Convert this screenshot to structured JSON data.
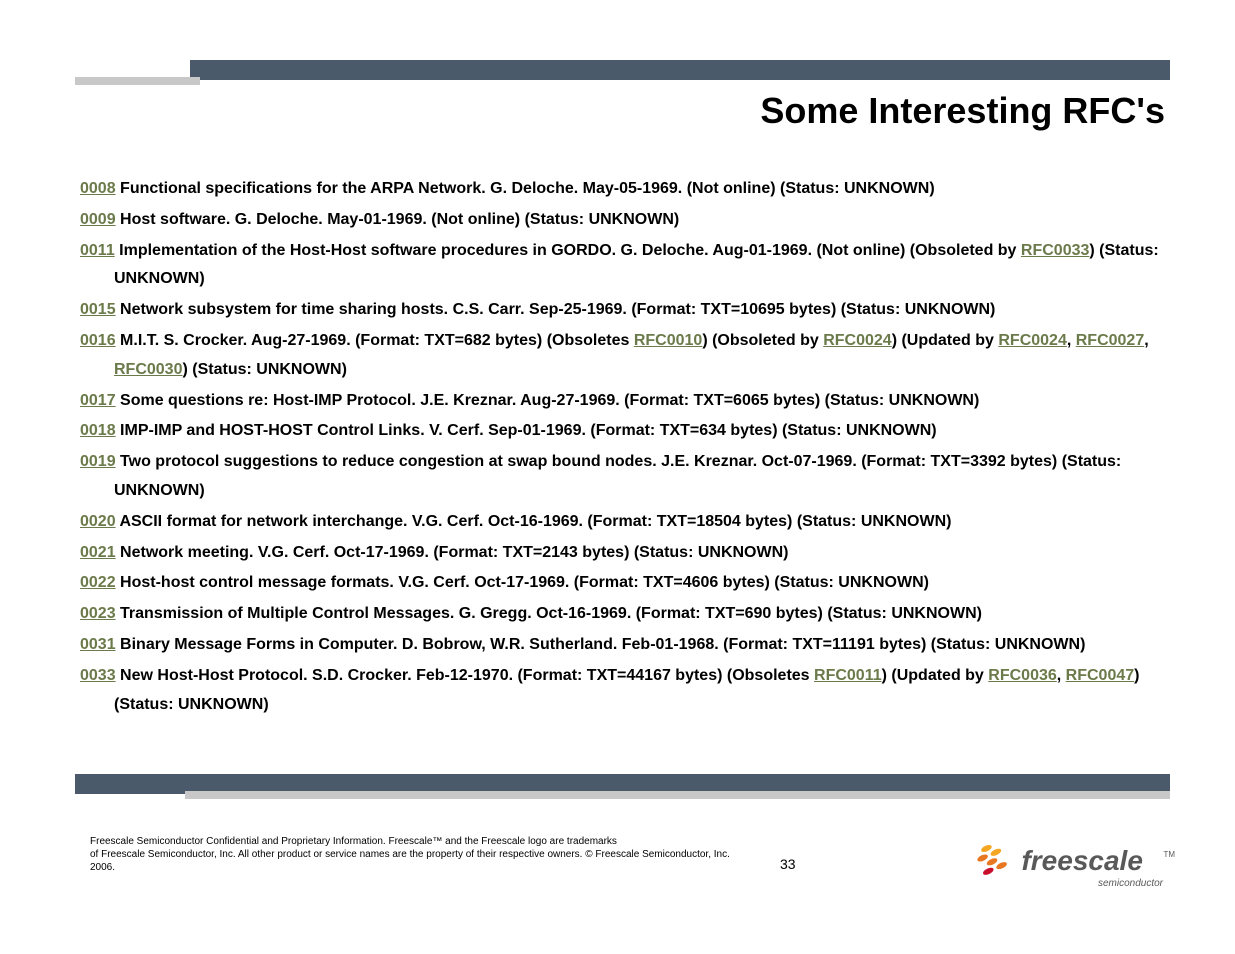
{
  "title": "Some Interesting RFC's",
  "items": [
    {
      "num": "0008",
      "text": " Functional specifications for the ARPA Network. G. Deloche. May-05-1969. (Not online) (Status: UNKNOWN)"
    },
    {
      "num": "0009",
      "text": " Host software. G. Deloche. May-01-1969. (Not online) (Status: UNKNOWN)"
    },
    {
      "num": "0011",
      "parts": [
        {
          "t": " Implementation of the Host-Host software procedures in GORDO. G. Deloche. Aug-01-1969. (Not online) (Obsoleted by "
        },
        {
          "l": "RFC0033"
        },
        {
          "t": ") (Status: UNKNOWN)"
        }
      ]
    },
    {
      "num": "0015",
      "text": " Network subsystem for time sharing hosts. C.S. Carr. Sep-25-1969. (Format: TXT=10695 bytes) (Status: UNKNOWN)"
    },
    {
      "num": "0016",
      "parts": [
        {
          "t": " M.I.T. S. Crocker. Aug-27-1969. (Format: TXT=682 bytes) (Obsoletes "
        },
        {
          "l": "RFC0010"
        },
        {
          "t": ") (Obsoleted by "
        },
        {
          "l": "RFC0024"
        },
        {
          "t": ") (Updated by "
        },
        {
          "l": "RFC0024"
        },
        {
          "t": ", "
        },
        {
          "l": "RFC0027"
        },
        {
          "t": ", "
        },
        {
          "l": "RFC0030"
        },
        {
          "t": ") (Status: UNKNOWN)"
        }
      ]
    },
    {
      "num": "0017",
      "text": " Some questions re: Host-IMP Protocol. J.E. Kreznar. Aug-27-1969. (Format: TXT=6065 bytes) (Status: UNKNOWN)"
    },
    {
      "num": "0018",
      "text": " IMP-IMP and HOST-HOST Control Links. V. Cerf. Sep-01-1969. (Format: TXT=634 bytes) (Status: UNKNOWN)"
    },
    {
      "num": "0019",
      "text": " Two protocol suggestions to reduce congestion at swap bound nodes. J.E. Kreznar. Oct-07-1969. (Format: TXT=3392 bytes) (Status: UNKNOWN)"
    },
    {
      "num": "0020",
      "text": " ASCII format for network interchange. V.G. Cerf. Oct-16-1969. (Format: TXT=18504 bytes) (Status: UNKNOWN)"
    },
    {
      "num": "0021",
      "text": " Network meeting. V.G. Cerf. Oct-17-1969. (Format: TXT=2143 bytes) (Status: UNKNOWN)"
    },
    {
      "num": "0022",
      "text": " Host-host control message formats. V.G. Cerf. Oct-17-1969. (Format: TXT=4606 bytes) (Status: UNKNOWN)"
    },
    {
      "num": "0023",
      "text": " Transmission of Multiple Control Messages. G. Gregg. Oct-16-1969. (Format: TXT=690 bytes) (Status: UNKNOWN)"
    },
    {
      "num": "0031",
      "text": " Binary Message Forms in Computer. D. Bobrow, W.R. Sutherland. Feb-01-1968. (Format: TXT=11191 bytes) (Status: UNKNOWN)"
    },
    {
      "num": "0033",
      "parts": [
        {
          "t": " New Host-Host Protocol. S.D. Crocker. Feb-12-1970. (Format: TXT=44167 bytes) (Obsoletes "
        },
        {
          "l": "RFC0011"
        },
        {
          "t": ") (Updated by "
        },
        {
          "l": "RFC0036"
        },
        {
          "t": ", "
        },
        {
          "l": "RFC0047"
        },
        {
          "t": ") (Status: UNKNOWN)"
        }
      ]
    }
  ],
  "footer": {
    "line1": "Freescale Semiconductor Confidential and Proprietary Information. Freescale™ and the Freescale logo are trademarks",
    "line2": "of Freescale Semiconductor, Inc. All other product or service names are the property of their respective owners. © Freescale Semiconductor, Inc. 2006."
  },
  "page_number": "33",
  "logo": {
    "text": "freescale",
    "sub": "semiconductor",
    "tm": "TM"
  }
}
